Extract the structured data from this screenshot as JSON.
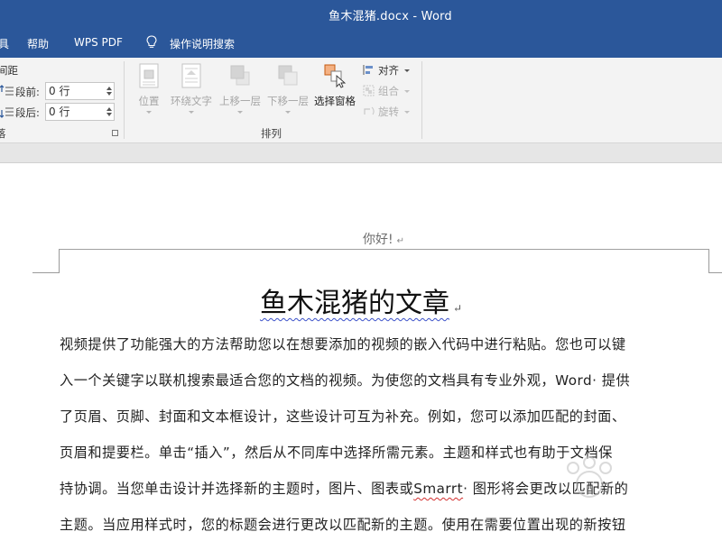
{
  "window": {
    "title": "鱼木混猪.docx  -  Word"
  },
  "menu": {
    "tabs": [
      {
        "label": "具"
      },
      {
        "label": "帮助"
      },
      {
        "label": "WPS PDF"
      }
    ],
    "tell_me": "操作说明搜索"
  },
  "ribbon": {
    "paragraph": {
      "spacing_label": "间距",
      "before_label": "段前:",
      "before_value": "0 行",
      "after_label": "段后:",
      "after_value": "0 行",
      "group_label_partial": "落"
    },
    "arrange": {
      "position": "位置",
      "wrap_text": "环绕文字",
      "bring_forward": "上移一层",
      "send_backward": "下移一层",
      "selection_pane": "选择窗格",
      "align": "对齐",
      "group": "组合",
      "rotate": "旋转",
      "group_label": "排列"
    }
  },
  "document": {
    "header_text": "你好!",
    "title": "鱼木混猪的文章",
    "paragraph_lines": [
      "视频提供了功能强大的方法帮助您以在想要添加的视频的嵌入代码中进行粘贴。您也可以键",
      "入一个关键字以联机搜索最适合您的文档的视频。为使您的文档具有专业外观，Word· 提供",
      "了页眉、页脚、封面和文本框设计，这些设计可互为补充。例如，您可以添加匹配的封面、",
      "页眉和提要栏。单击“插入”，然后从不同库中选择所需元素。主题和样式也有助于文档保",
      "持协调。当您单击设计并选择新的主题时，图片、图表或",
      "Smarrt",
      "· 图形将会更改以匹配新的",
      "主题。当应用样式时，您的标题会进行更改以匹配新的主题。使用在需要位置出现的新按钮"
    ]
  },
  "colors": {
    "accent": "#2b579a",
    "ribbon_bg": "#f3f3f3",
    "spell_error": "#d32f2f",
    "grammar": "#3a50c8"
  },
  "icons": [
    "lightbulb-icon",
    "spacing-before-icon",
    "spacing-after-icon",
    "position-icon",
    "wrap-text-icon",
    "bring-forward-icon",
    "send-backward-icon",
    "selection-pane-icon",
    "align-icon",
    "group-icon",
    "rotate-icon",
    "dialog-launcher-icon"
  ]
}
